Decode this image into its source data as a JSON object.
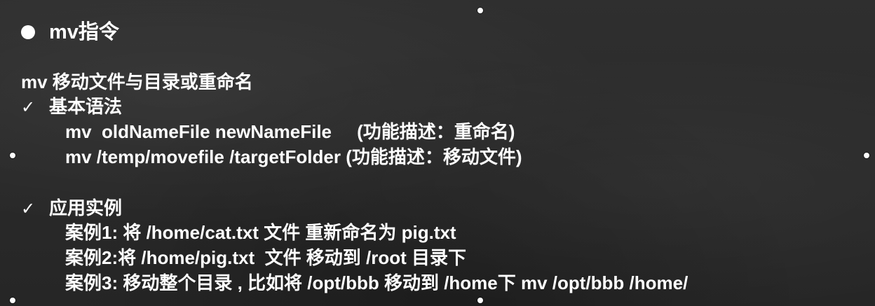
{
  "slide": {
    "title": "mv指令",
    "description": "mv 移动文件与目录或重命名",
    "syntax_section": {
      "heading": "基本语法",
      "lines": [
        "mv  oldNameFile newNameFile     (功能描述：重命名)",
        "mv /temp/movefile /targetFolder (功能描述：移动文件)"
      ]
    },
    "examples_section": {
      "heading": "应用实例",
      "lines": [
        "案例1: 将 /home/cat.txt 文件 重新命名为 pig.txt",
        "案例2:将 /home/pig.txt  文件 移动到 /root 目录下",
        "案例3: 移动整个目录 , 比如将 /opt/bbb 移动到 /home下 mv /opt/bbb /home/"
      ]
    },
    "check_glyph": "✓",
    "colors": {
      "background": "#2c2c2c",
      "text": "#ffffff"
    }
  }
}
